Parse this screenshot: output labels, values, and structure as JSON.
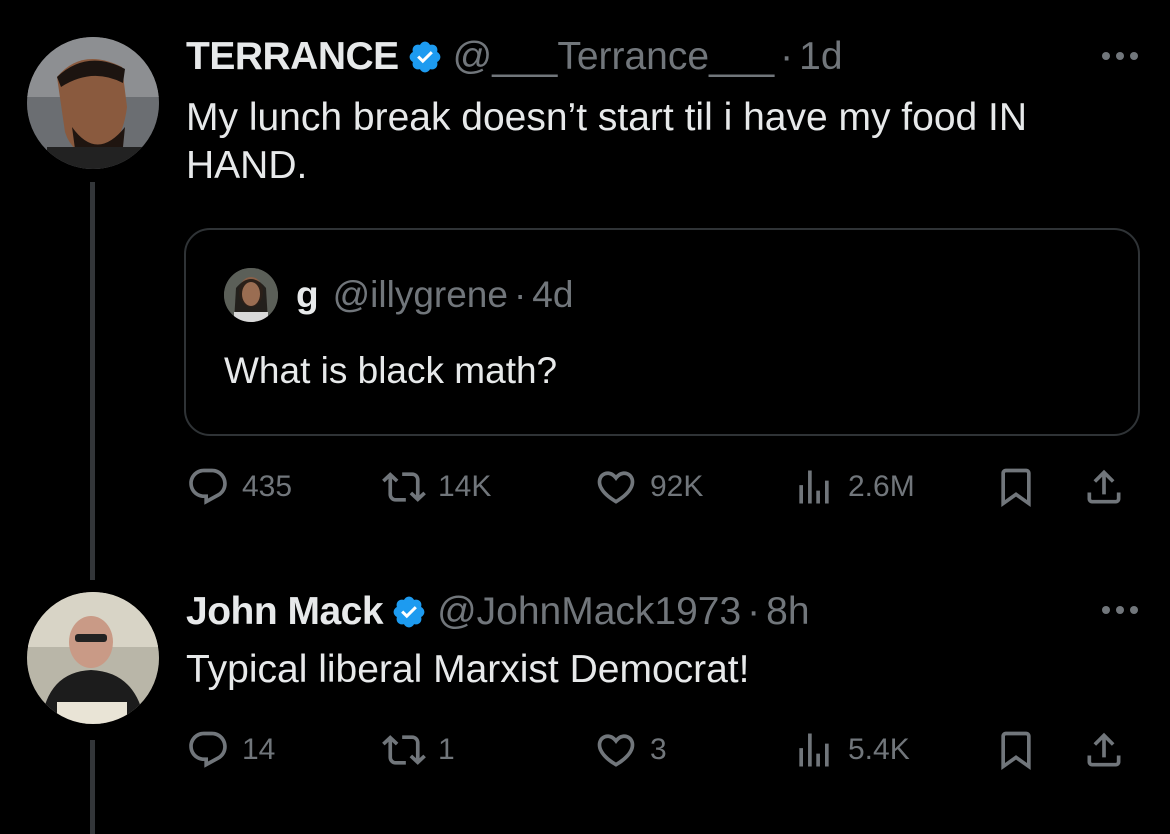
{
  "tweets": [
    {
      "name": "TERRANCE",
      "handle": "@___Terrance___",
      "dot": "·",
      "time": "1d",
      "text": "My lunch break doesn’t start til i have my food IN HAND.",
      "quote": {
        "name": "g",
        "handle": "@illygrene",
        "dot": "·",
        "time": "4d",
        "text": "What is black math?"
      },
      "stats": {
        "replies": "435",
        "reposts": "14K",
        "likes": "92K",
        "views": "2.6M"
      }
    },
    {
      "name": "John Mack",
      "handle": "@JohnMack1973",
      "dot": "·",
      "time": "8h",
      "text": "Typical liberal Marxist Democrat!",
      "stats": {
        "replies": "14",
        "reposts": "1",
        "likes": "3",
        "views": "5.4K"
      }
    }
  ],
  "colors": {
    "background": "#000000",
    "text": "#e7e9ea",
    "muted": "#71767b",
    "verified": "#1d9bf0",
    "border": "#2f3336"
  },
  "icons": [
    "reply-icon",
    "repost-icon",
    "like-icon",
    "views-icon",
    "bookmark-icon",
    "share-icon",
    "verified-badge-icon",
    "more-icon"
  ]
}
